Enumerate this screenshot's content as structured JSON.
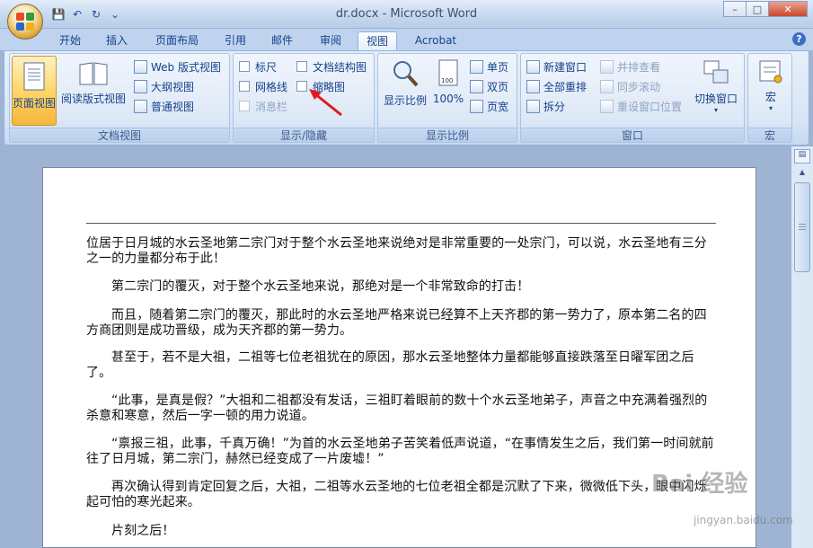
{
  "window": {
    "title": "dr.docx - Microsoft Word"
  },
  "qat": {
    "save": "💾",
    "undo": "↶",
    "redo": "↻",
    "customize": "⌄"
  },
  "tabs": [
    "开始",
    "插入",
    "页面布局",
    "引用",
    "邮件",
    "审阅",
    "视图",
    "Acrobat"
  ],
  "ribbon": {
    "doc_views": {
      "label": "文档视图",
      "print_layout": "页面视图",
      "full_screen_reading": "阅读版式视图",
      "web_layout": "Web 版式视图",
      "outline": "大纲视图",
      "draft": "普通视图"
    },
    "show_hide": {
      "label": "显示/隐藏",
      "ruler": "标尺",
      "gridlines": "网格线",
      "message_bar": "消息栏",
      "document_map": "文档结构图",
      "thumbnails": "缩略图"
    },
    "zoom": {
      "label": "显示比例",
      "zoom": "显示比例",
      "hundred": "100%",
      "one_page": "单页",
      "two_pages": "双页",
      "page_width": "页宽"
    },
    "window": {
      "label": "窗口",
      "new_window": "新建窗口",
      "arrange_all": "全部重排",
      "split": "拆分",
      "side_by_side": "并排查看",
      "sync_scroll": "同步滚动",
      "reset_position": "重设窗口位置",
      "switch_windows": "切换窗口"
    },
    "macros": {
      "label": "宏",
      "macros": "宏"
    }
  },
  "document": {
    "paragraphs": [
      "位居于日月城的水云圣地第二宗门对于整个水云圣地来说绝对是非常重要的一处宗门，可以说，水云圣地有三分之一的力量都分布于此！",
      "第二宗门的覆灭，对于整个水云圣地来说，那绝对是一个非常致命的打击！",
      "而且，随着第二宗门的覆灭，那此时的水云圣地严格来说已经算不上天齐郡的第一势力了，原本第二名的四方商团则是成功晋级，成为天齐郡的第一势力。",
      "甚至于，若不是大祖，二祖等七位老祖犹在的原因，那水云圣地整体力量都能够直接跌落至日曜军团之后了。",
      "“此事，是真是假？”大祖和二祖都没有发话，三祖盯着眼前的数十个水云圣地弟子，声音之中充满着强烈的杀意和寒意，然后一字一顿的用力说道。",
      "“禀报三祖，此事，千真万确！”为首的水云圣地弟子苦笑着低声说道，“在事情发生之后，我们第一时间就前往了日月城，第二宗门，赫然已经变成了一片废墟！”",
      "再次确认得到肯定回复之后，大祖，二祖等水云圣地的七位老祖全都是沉默了下来，微微低下头，眼中闪烁起可怕的寒光起来。",
      "片刻之后！"
    ]
  },
  "watermark": {
    "main": "Bai 经验",
    "sub": "jingyan.baidu.com"
  }
}
